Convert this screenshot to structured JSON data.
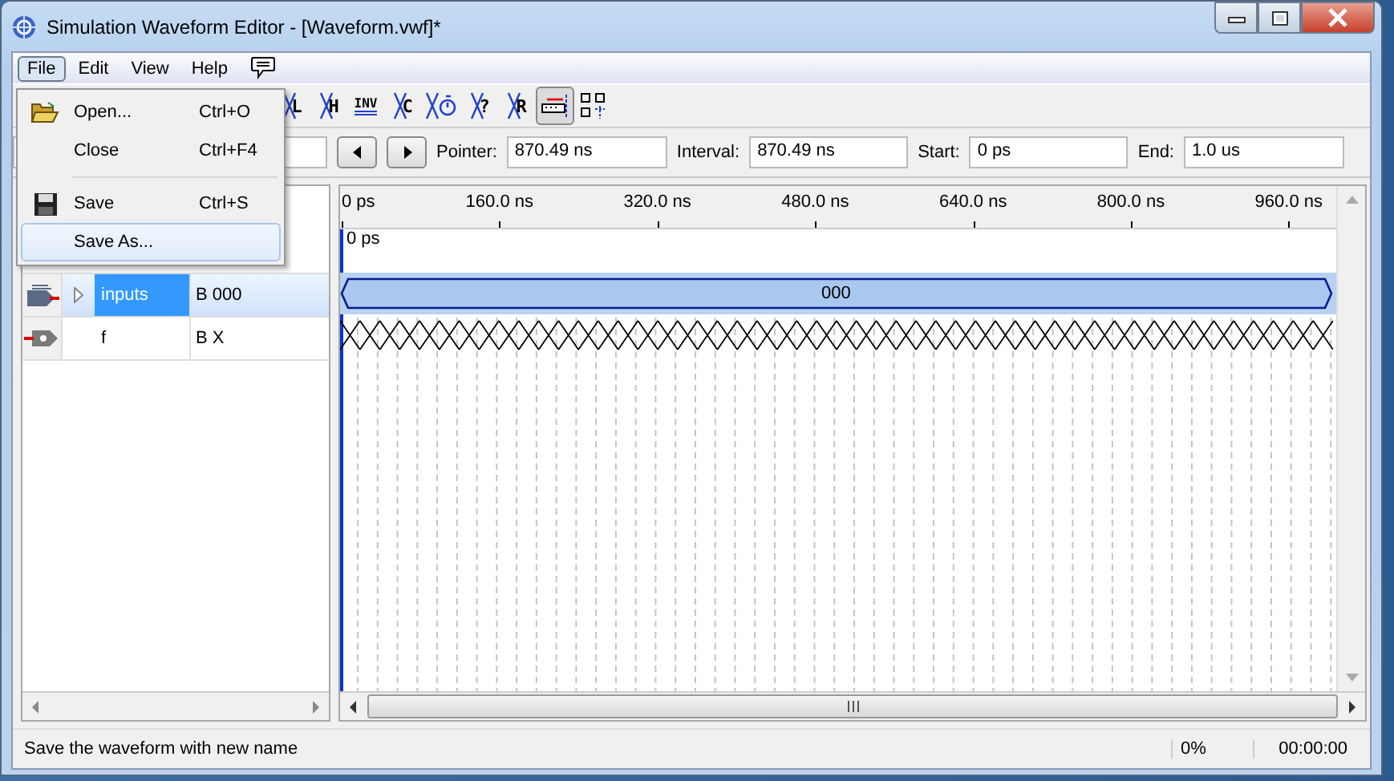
{
  "window": {
    "title": "Simulation Waveform Editor - [Waveform.vwf]*"
  },
  "menu_bar": [
    {
      "label": "File",
      "selected": true
    },
    {
      "label": "Edit",
      "selected": false
    },
    {
      "label": "View",
      "selected": false
    },
    {
      "label": "Help",
      "selected": false
    }
  ],
  "file_menu": [
    {
      "kind": "open",
      "label": "Open...",
      "shortcut": "Ctrl+O",
      "selected": false
    },
    {
      "kind": "plain",
      "label": "Close",
      "shortcut": "Ctrl+F4",
      "selected": false
    },
    {
      "kind": "separator"
    },
    {
      "kind": "save",
      "label": "Save",
      "shortcut": "Ctrl+S",
      "selected": false
    },
    {
      "kind": "plain",
      "label": "Save As...",
      "selected": true
    }
  ],
  "toolbar": [
    {
      "kind": "value",
      "label": "L",
      "pressed": false
    },
    {
      "kind": "value",
      "label": "H",
      "pressed": false
    },
    {
      "kind": "invert",
      "label": "INV",
      "pressed": false
    },
    {
      "kind": "value",
      "label": "C",
      "pressed": false
    },
    {
      "kind": "timer",
      "pressed": false
    },
    {
      "kind": "value",
      "label": "?",
      "pressed": false
    },
    {
      "kind": "value",
      "label": "R",
      "pressed": false
    },
    {
      "kind": "snap",
      "pressed": true
    },
    {
      "kind": "grid",
      "pressed": false
    }
  ],
  "time_fields": [
    {
      "label": "Pointer:",
      "value": "870.49 ns"
    },
    {
      "label": "Interval:",
      "value": "870.49 ns"
    },
    {
      "label": "Start:",
      "value": "0 ps"
    },
    {
      "label": "End:",
      "value": "1.0 us"
    }
  ],
  "ruler": {
    "ticks": [
      "0 ps",
      "160.0 ns",
      "320.0 ns",
      "480.0 ns",
      "640.0 ns",
      "800.0 ns",
      "960.0 ns"
    ],
    "marker": "0 ps"
  },
  "nodes": [
    {
      "kind": "input",
      "name": "inputs",
      "value": "B 000",
      "selected": true,
      "expandable": true,
      "wave": {
        "kind": "bus",
        "value": "000"
      }
    },
    {
      "kind": "output",
      "name": "f",
      "value": "B X",
      "selected": false,
      "expandable": false,
      "wave": {
        "kind": "unknown"
      }
    }
  ],
  "status_bar": {
    "message": "Save the waveform with new name",
    "progress": "0%",
    "time": "00:00:00"
  }
}
